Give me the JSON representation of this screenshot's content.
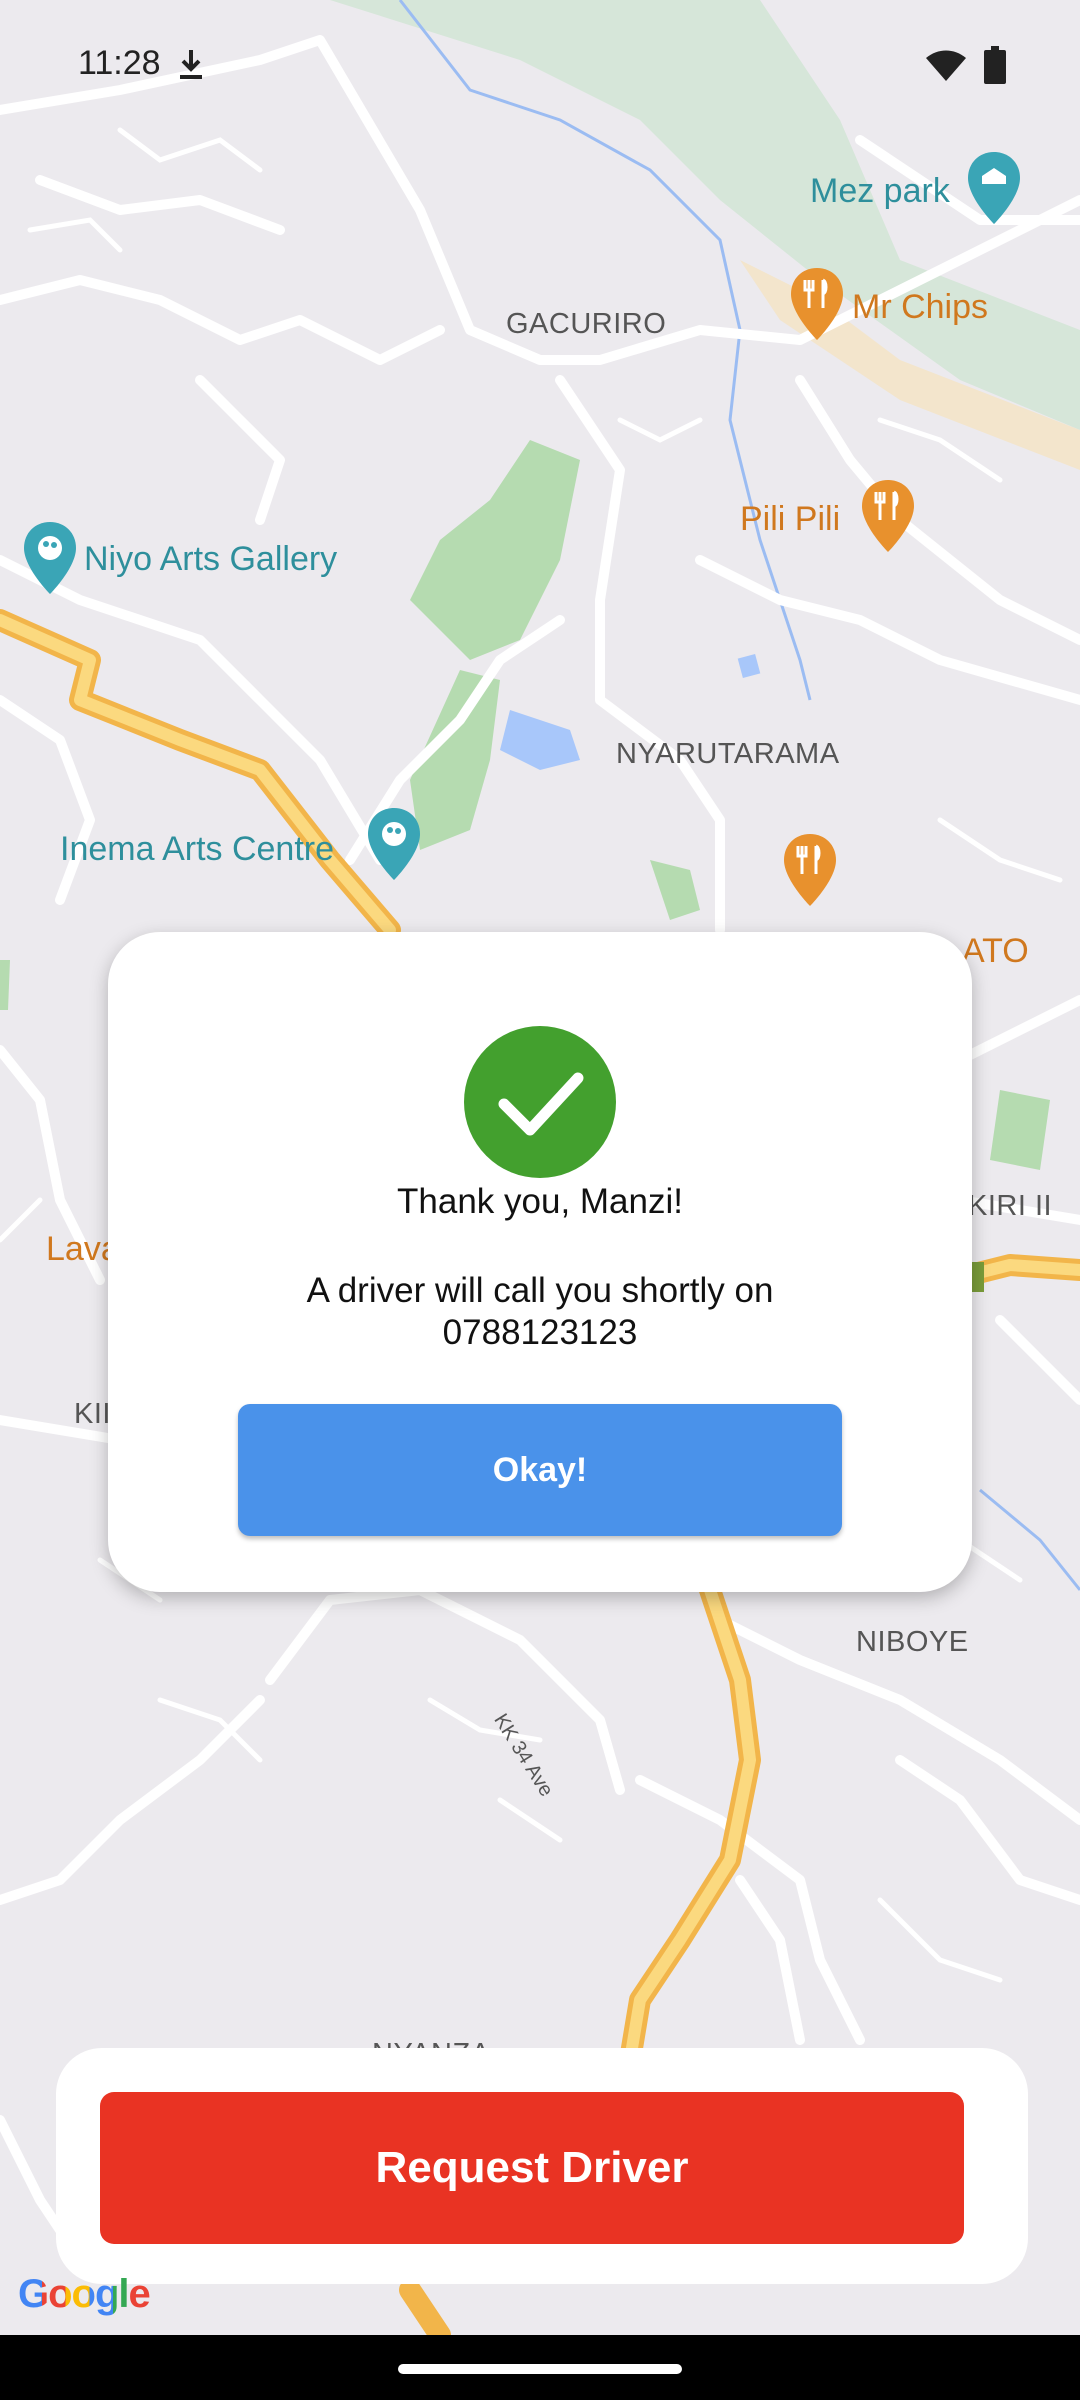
{
  "status_bar": {
    "time": "11:28"
  },
  "map": {
    "pois": {
      "mez_park": "Mez park",
      "mr_chips": "Mr Chips",
      "pili_pili": "Pili Pili",
      "niyo_arts": "Niyo Arts Gallery",
      "inema_arts": "Inema Arts Centre",
      "lava_partial": "Lava",
      "ato_partial": "ATO"
    },
    "areas": {
      "gacuriro": "GACURIRO",
      "nyarutarama": "NYARUTARAMA",
      "niboye": "NIBOYE",
      "kiri_partial": "KIRI II",
      "ki_partial": "KII",
      "nyanza_partial": "NYANZA"
    },
    "roads": {
      "kk34": "KK 34 Ave"
    },
    "attribution": "Google"
  },
  "dialog": {
    "title": "Thank you, Manzi!",
    "message_line1": "A driver will call you shortly on",
    "message_line2": "0788123123",
    "ok_label": "Okay!"
  },
  "bottom": {
    "request_label": "Request Driver"
  },
  "colors": {
    "success": "#43a02e",
    "primary": "#4a92ea",
    "danger": "#e93323",
    "map_bg": "#eceaee",
    "park": "#b5dbb0",
    "water": "#a8c7fa",
    "highway": "#f9c95a",
    "poi_food": "#e8912d",
    "poi_culture": "#3aa5b6"
  },
  "icons": {
    "check": "check-icon",
    "download": "download-icon",
    "wifi": "wifi-icon",
    "battery": "battery-icon",
    "restaurant": "restaurant-pin-icon",
    "gallery": "gallery-pin-icon",
    "park": "park-pin-icon"
  }
}
